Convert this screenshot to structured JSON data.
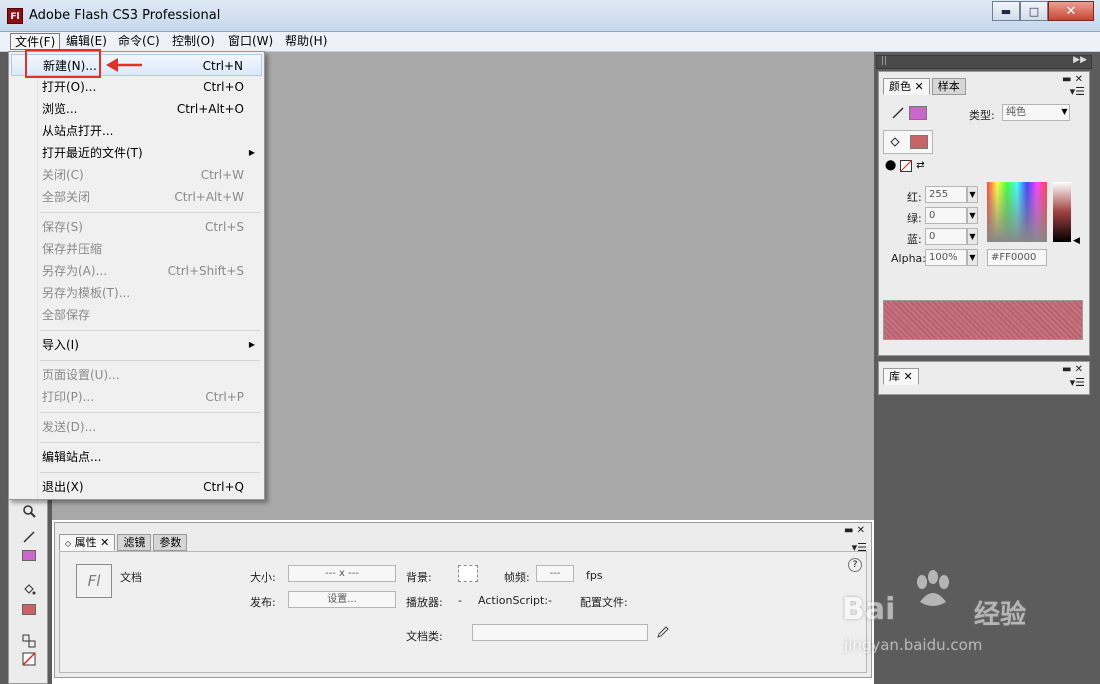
{
  "window": {
    "app_icon": "Fl",
    "title": "Adobe Flash CS3 Professional",
    "buttons": {
      "minimize": "▬",
      "maximize": "□",
      "close": "✕"
    }
  },
  "menubar": {
    "items": [
      {
        "label": "文件(F)"
      },
      {
        "label": "编辑(E)"
      },
      {
        "label": "命令(C)"
      },
      {
        "label": "控制(O)"
      },
      {
        "label": "窗口(W)"
      },
      {
        "label": "帮助(H)"
      }
    ]
  },
  "file_menu": {
    "items": [
      {
        "label": "新建(N)...",
        "shortcut": "Ctrl+N"
      },
      {
        "label": "打开(O)...",
        "shortcut": "Ctrl+O"
      },
      {
        "label": "浏览...",
        "shortcut": "Ctrl+Alt+O"
      },
      {
        "label": "从站点打开...",
        "shortcut": ""
      },
      {
        "label": "打开最近的文件(T)",
        "shortcut": ""
      },
      {
        "label": "关闭(C)",
        "shortcut": "Ctrl+W"
      },
      {
        "label": "全部关闭",
        "shortcut": "Ctrl+Alt+W"
      },
      {
        "label": "保存(S)",
        "shortcut": "Ctrl+S"
      },
      {
        "label": "保存并压缩",
        "shortcut": ""
      },
      {
        "label": "另存为(A)...",
        "shortcut": "Ctrl+Shift+S"
      },
      {
        "label": "另存为模板(T)...",
        "shortcut": ""
      },
      {
        "label": "全部保存",
        "shortcut": ""
      },
      {
        "label": "导入(I)",
        "shortcut": ""
      },
      {
        "label": "页面设置(U)...",
        "shortcut": ""
      },
      {
        "label": "打印(P)...",
        "shortcut": "Ctrl+P"
      },
      {
        "label": "发送(D)...",
        "shortcut": ""
      },
      {
        "label": "编辑站点...",
        "shortcut": ""
      },
      {
        "label": "退出(X)",
        "shortcut": "Ctrl+Q"
      }
    ],
    "submenu_arrow": "▶"
  },
  "color_panel": {
    "tabs": [
      "颜色",
      "样本"
    ],
    "type_label": "类型:",
    "type_value": "纯色",
    "red_label": "红:",
    "red_value": "255",
    "green_label": "绿:",
    "green_value": "0",
    "blue_label": "蓝:",
    "blue_value": "0",
    "alpha_label": "Alpha:",
    "alpha_value": "100%",
    "hex_value": "#FF0000",
    "stroke_color": "#cc66cc",
    "fill_color": "#c86464"
  },
  "library_panel": {
    "tabs": [
      "库"
    ]
  },
  "properties_panel": {
    "tabs": [
      "属性",
      "滤镜",
      "参数"
    ],
    "doc_icon": "Fl",
    "doc_label": "文档",
    "size_label": "大小:",
    "size_value": "--- x ---",
    "bg_label": "背景:",
    "fps_label": "帧频:",
    "fps_value": "---",
    "fps_unit": "fps",
    "publish_label": "发布:",
    "settings_button": "设置...",
    "player_label": "播放器:",
    "player_value": "-",
    "actionscript_label": "ActionScript:",
    "actionscript_value": "-",
    "profile_label": "配置文件:",
    "doc_class_label": "文档类:",
    "help_icon": "?"
  },
  "watermark": {
    "brand": "Bai",
    "brand2": "经验",
    "url": "jingyan.baidu.com"
  }
}
